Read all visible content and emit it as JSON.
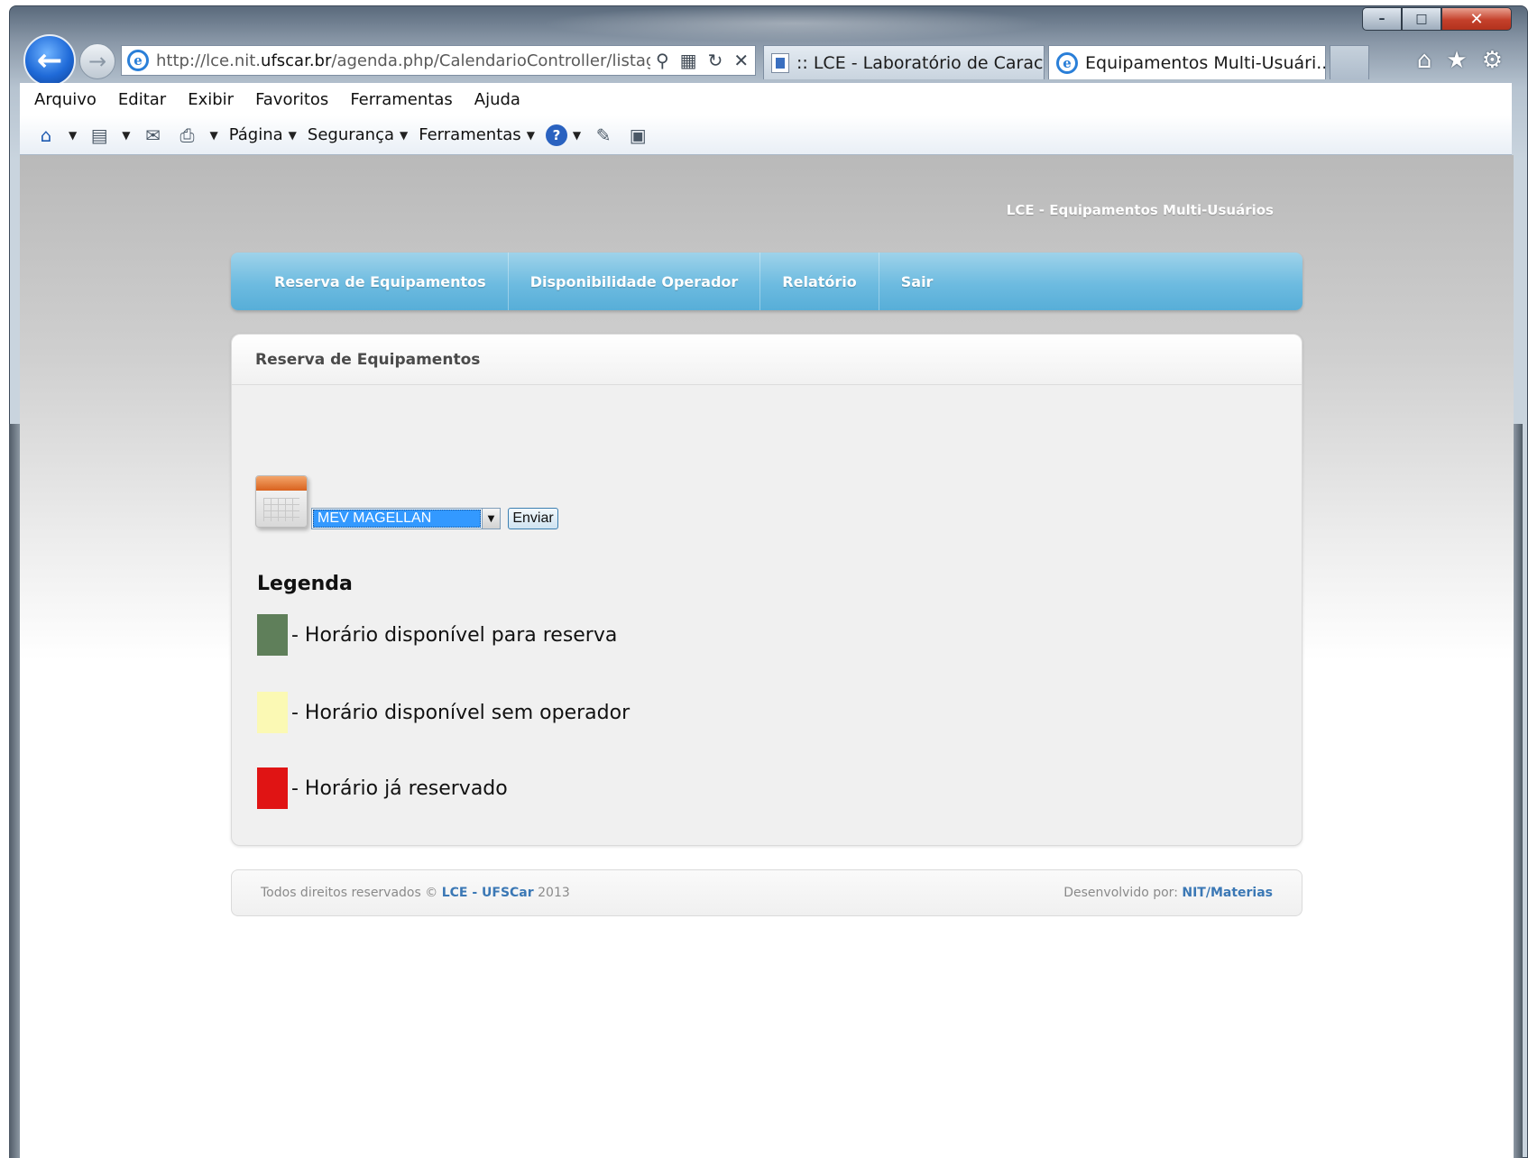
{
  "browser": {
    "url_prefix": "http://lce.nit.",
    "url_domain": "ufscar.br",
    "url_path": "/agenda.php/CalendarioController/listage",
    "tabs": [
      {
        "label": ":: LCE - Laboratório de Caracte...",
        "active": false
      },
      {
        "label": "Equipamentos Multi-Usuári...",
        "active": true
      }
    ],
    "menu": [
      "Arquivo",
      "Editar",
      "Exibir",
      "Favoritos",
      "Ferramentas",
      "Ajuda"
    ],
    "commands": {
      "page": "Página",
      "security": "Segurança",
      "tools": "Ferramentas"
    }
  },
  "site": {
    "title": "LCE - Equipamentos Multi-Usuários",
    "nav": [
      "Reserva de Equipamentos",
      "Disponibilidade Operador",
      "Relatório",
      "Sair"
    ]
  },
  "content": {
    "header": "Reserva de Equipamentos",
    "equipment_select_value": "MEV MAGELLAN",
    "send_label": "Enviar",
    "legend_title": "Legenda",
    "legend": [
      {
        "color": "#5f7f5a",
        "text": "- Horário disponível para reserva"
      },
      {
        "color": "#fbf9b4",
        "text": "- Horário disponível sem operador"
      },
      {
        "color": "#e01414",
        "text": "- Horário já reservado"
      }
    ]
  },
  "footer": {
    "rights_prefix": "Todos direitos reservados ©",
    "rights_link": "LCE - UFSCar",
    "rights_year": "2013",
    "dev_prefix": "Desenvolvido por:",
    "dev_link": "NIT/Materias"
  }
}
